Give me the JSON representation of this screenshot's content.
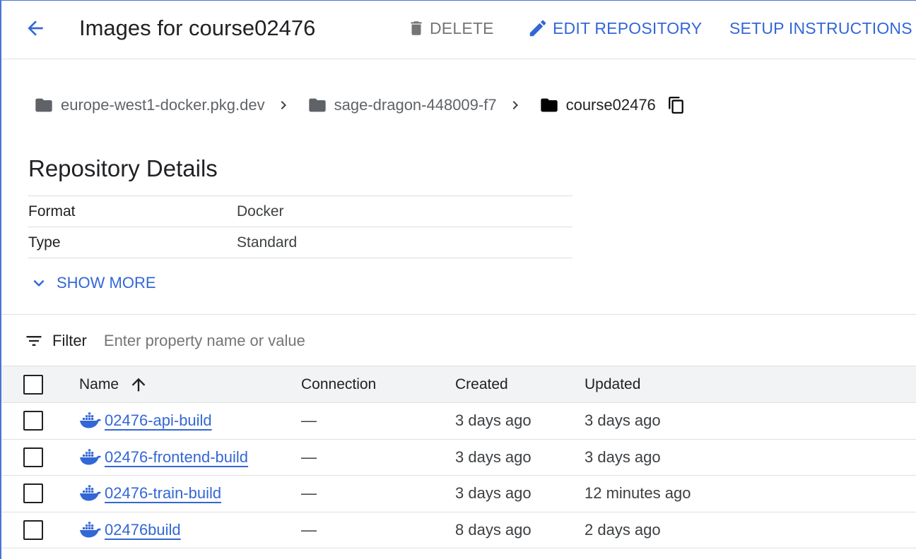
{
  "header": {
    "title": "Images for course02476",
    "delete_label": "DELETE",
    "edit_label": "EDIT REPOSITORY",
    "setup_label": "SETUP INSTRUCTIONS"
  },
  "breadcrumb": [
    {
      "label": "europe-west1-docker.pkg.dev"
    },
    {
      "label": "sage-dragon-448009-f7"
    },
    {
      "label": "course02476"
    }
  ],
  "details": {
    "title": "Repository Details",
    "rows": [
      {
        "key": "Format",
        "value": "Docker"
      },
      {
        "key": "Type",
        "value": "Standard"
      }
    ],
    "show_more": "SHOW MORE"
  },
  "filter": {
    "label": "Filter",
    "placeholder": "Enter property name or value"
  },
  "table": {
    "columns": {
      "name": "Name",
      "connection": "Connection",
      "created": "Created",
      "updated": "Updated"
    },
    "rows": [
      {
        "name": "02476-api-build",
        "connection": "—",
        "created": "3 days ago",
        "updated": "3 days ago"
      },
      {
        "name": "02476-frontend-build",
        "connection": "—",
        "created": "3 days ago",
        "updated": "3 days ago"
      },
      {
        "name": "02476-train-build",
        "connection": "—",
        "created": "3 days ago",
        "updated": "12 minutes ago"
      },
      {
        "name": "02476build",
        "connection": "—",
        "created": "8 days ago",
        "updated": "2 days ago"
      }
    ]
  },
  "colors": {
    "accent": "#3367d6",
    "muted": "#757575",
    "header_bg": "#f1f3f4"
  },
  "icons": [
    "arrow-back-icon",
    "trash-icon",
    "pencil-icon",
    "folder-icon",
    "chevron-right-icon",
    "copy-icon",
    "chevron-down-icon",
    "filter-icon",
    "arrow-up-icon",
    "docker-icon"
  ]
}
